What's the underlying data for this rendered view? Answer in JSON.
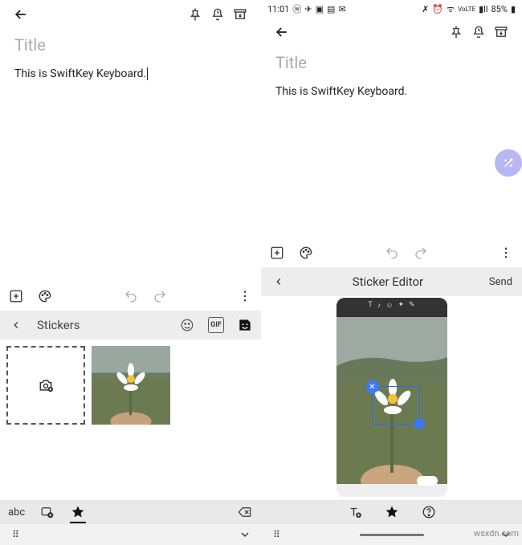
{
  "left": {
    "title_placeholder": "Title",
    "note_body": "This is SwiftKey Keyboard.",
    "stickers_label": "Stickers",
    "abc_label": "abc",
    "gif_label": "GIF"
  },
  "right": {
    "status_time": "11:01",
    "status_battery": "85%",
    "title_placeholder": "Title",
    "note_body": "This is SwiftKey Keyboard.",
    "editor_title": "Sticker Editor",
    "send_label": "Send"
  },
  "watermark": "wsxdn.com"
}
